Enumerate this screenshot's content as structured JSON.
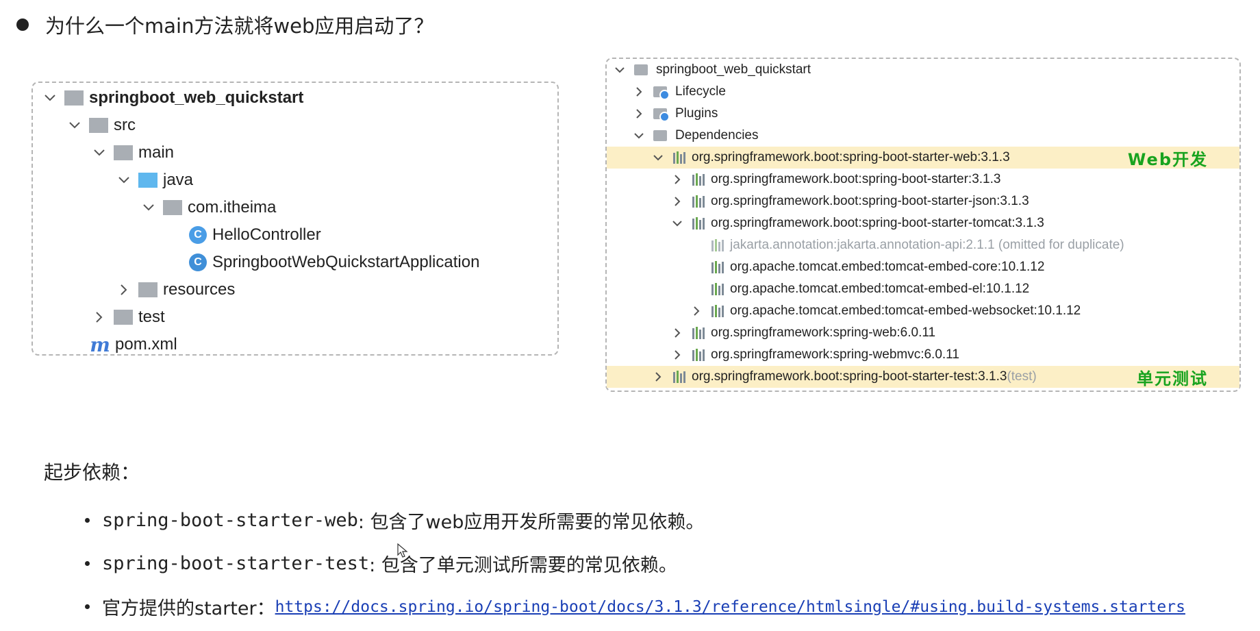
{
  "heading": {
    "text": "为什么一个main方法就将web应用启动了？"
  },
  "project_tree": {
    "items": [
      {
        "label": "springboot_web_quickstart",
        "icon": "project-folder-icon",
        "expanded": true
      },
      {
        "label": "src",
        "icon": "folder-icon",
        "expanded": true
      },
      {
        "label": "main",
        "icon": "folder-icon",
        "expanded": true
      },
      {
        "label": "java",
        "icon": "source-folder-icon",
        "expanded": true
      },
      {
        "label": "com.itheima",
        "icon": "package-icon",
        "expanded": true
      },
      {
        "label": "HelloController",
        "icon": "class-icon"
      },
      {
        "label": "SpringbootWebQuickstartApplication",
        "icon": "spring-class-icon"
      },
      {
        "label": "resources",
        "icon": "resources-folder-icon",
        "expanded": false
      },
      {
        "label": "test",
        "icon": "folder-icon",
        "expanded": false
      },
      {
        "label": "pom.xml",
        "icon": "maven-icon"
      }
    ]
  },
  "maven_tree": {
    "items": [
      {
        "label": "springboot_web_quickstart",
        "icon": "maven-project-icon",
        "expanded": true
      },
      {
        "label": "Lifecycle",
        "icon": "lifecycle-folder-icon",
        "expanded": false
      },
      {
        "label": "Plugins",
        "icon": "plugins-folder-icon",
        "expanded": false
      },
      {
        "label": "Dependencies",
        "icon": "dependencies-folder-icon",
        "expanded": true
      },
      {
        "label": "org.springframework.boot:spring-boot-starter-web:3.1.3",
        "icon": "library-icon",
        "expanded": true,
        "highlight": true
      },
      {
        "label": "org.springframework.boot:spring-boot-starter:3.1.3",
        "icon": "library-icon",
        "expanded": false
      },
      {
        "label": "org.springframework.boot:spring-boot-starter-json:3.1.3",
        "icon": "library-icon",
        "expanded": false
      },
      {
        "label": "org.springframework.boot:spring-boot-starter-tomcat:3.1.3",
        "icon": "library-icon",
        "expanded": true
      },
      {
        "label": "jakarta.annotation:jakarta.annotation-api:2.1.1 (omitted for duplicate)",
        "icon": "library-icon",
        "muted": true
      },
      {
        "label": "org.apache.tomcat.embed:tomcat-embed-core:10.1.12",
        "icon": "library-icon"
      },
      {
        "label": "org.apache.tomcat.embed:tomcat-embed-el:10.1.12",
        "icon": "library-icon"
      },
      {
        "label": "org.apache.tomcat.embed:tomcat-embed-websocket:10.1.12",
        "icon": "library-icon",
        "expanded": false
      },
      {
        "label": "org.springframework:spring-web:6.0.11",
        "icon": "library-icon",
        "expanded": false
      },
      {
        "label": "org.springframework:spring-webmvc:6.0.11",
        "icon": "library-icon",
        "expanded": false
      },
      {
        "label": "org.springframework.boot:spring-boot-starter-test:3.1.3",
        "suffix": " (test)",
        "icon": "library-icon",
        "expanded": false,
        "highlight": true
      }
    ],
    "annotations": {
      "web": "Web开发",
      "test": "单元测试"
    }
  },
  "starter_section": {
    "title": "起步依赖：",
    "bullets": [
      {
        "code": "spring-boot-starter-web",
        "text": ": 包含了web应用开发所需要的常见依赖。"
      },
      {
        "code": "spring-boot-starter-test",
        "text": ": 包含了单元测试所需要的常见依赖。"
      },
      {
        "prefix": "官方提供的starter：",
        "link": "https://docs.spring.io/spring-boot/docs/3.1.3/reference/htmlsingle/#using.build-systems.starters"
      }
    ]
  },
  "colors": {
    "highlight": "#fcefc6",
    "annotation": "#18a31f",
    "link": "#1a3fb5"
  }
}
